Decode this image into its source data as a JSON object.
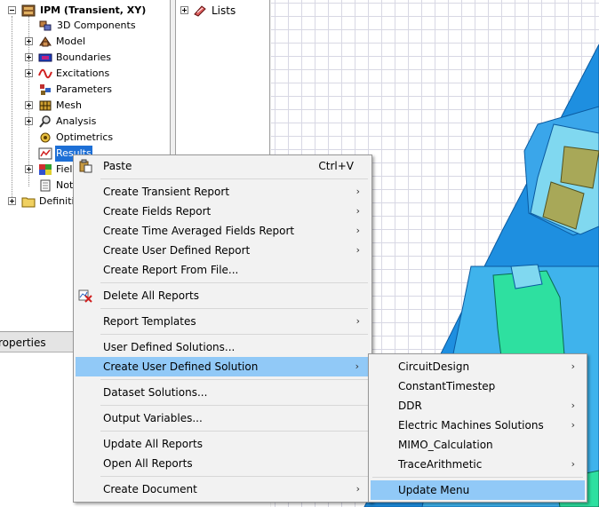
{
  "tree": {
    "root_label": "IPM (Transient, XY)",
    "items": [
      {
        "label": "3D Components",
        "icon": "3d-components-icon"
      },
      {
        "label": "Model",
        "icon": "model-icon"
      },
      {
        "label": "Boundaries",
        "icon": "boundaries-icon"
      },
      {
        "label": "Excitations",
        "icon": "excitations-icon"
      },
      {
        "label": "Parameters",
        "icon": "parameters-icon"
      },
      {
        "label": "Mesh",
        "icon": "mesh-icon"
      },
      {
        "label": "Analysis",
        "icon": "analysis-icon"
      },
      {
        "label": "Optimetrics",
        "icon": "optimetrics-icon"
      },
      {
        "label": "Results",
        "icon": "results-icon"
      },
      {
        "label": "Fiel",
        "icon": "field-overlays-icon"
      },
      {
        "label": "Not",
        "icon": "notes-icon"
      }
    ],
    "definitions_label": "Definiti"
  },
  "lists_panel": {
    "label": "Lists"
  },
  "properties_panel": {
    "title": "roperties"
  },
  "context_menu": {
    "paste": {
      "label": "Paste",
      "shortcut": "Ctrl+V"
    },
    "create_transient_report": "Create Transient Report",
    "create_fields_report": "Create Fields Report",
    "create_time_averaged_fields_report": "Create Time Averaged Fields Report",
    "create_user_defined_report": "Create User Defined Report",
    "create_report_from_file": "Create Report From File...",
    "delete_all_reports": "Delete All Reports",
    "report_templates": "Report Templates",
    "user_defined_solutions": "User Defined Solutions...",
    "create_user_defined_solution": "Create User Defined Solution",
    "dataset_solutions": "Dataset Solutions...",
    "output_variables": "Output Variables...",
    "update_all_reports": "Update All Reports",
    "open_all_reports": "Open All Reports",
    "create_document": "Create Document"
  },
  "submenu": {
    "circuit_design": "CircuitDesign",
    "constant_timestep": "ConstantTimestep",
    "ddr": "DDR",
    "electric_machines_solutions": "Electric Machines Solutions",
    "mimo_calculation": "MIMO_Calculation",
    "trace_arithmetic": "TraceArithmetic",
    "update_menu": "Update Menu"
  },
  "colors": {
    "menu_highlight": "#91c9f7",
    "stator": "#1e8fe0",
    "rotor": "#3fb3ec",
    "magnet_slot": "#80d8f0",
    "magnet": "#a8a858",
    "winding": "#2ee0a0"
  }
}
